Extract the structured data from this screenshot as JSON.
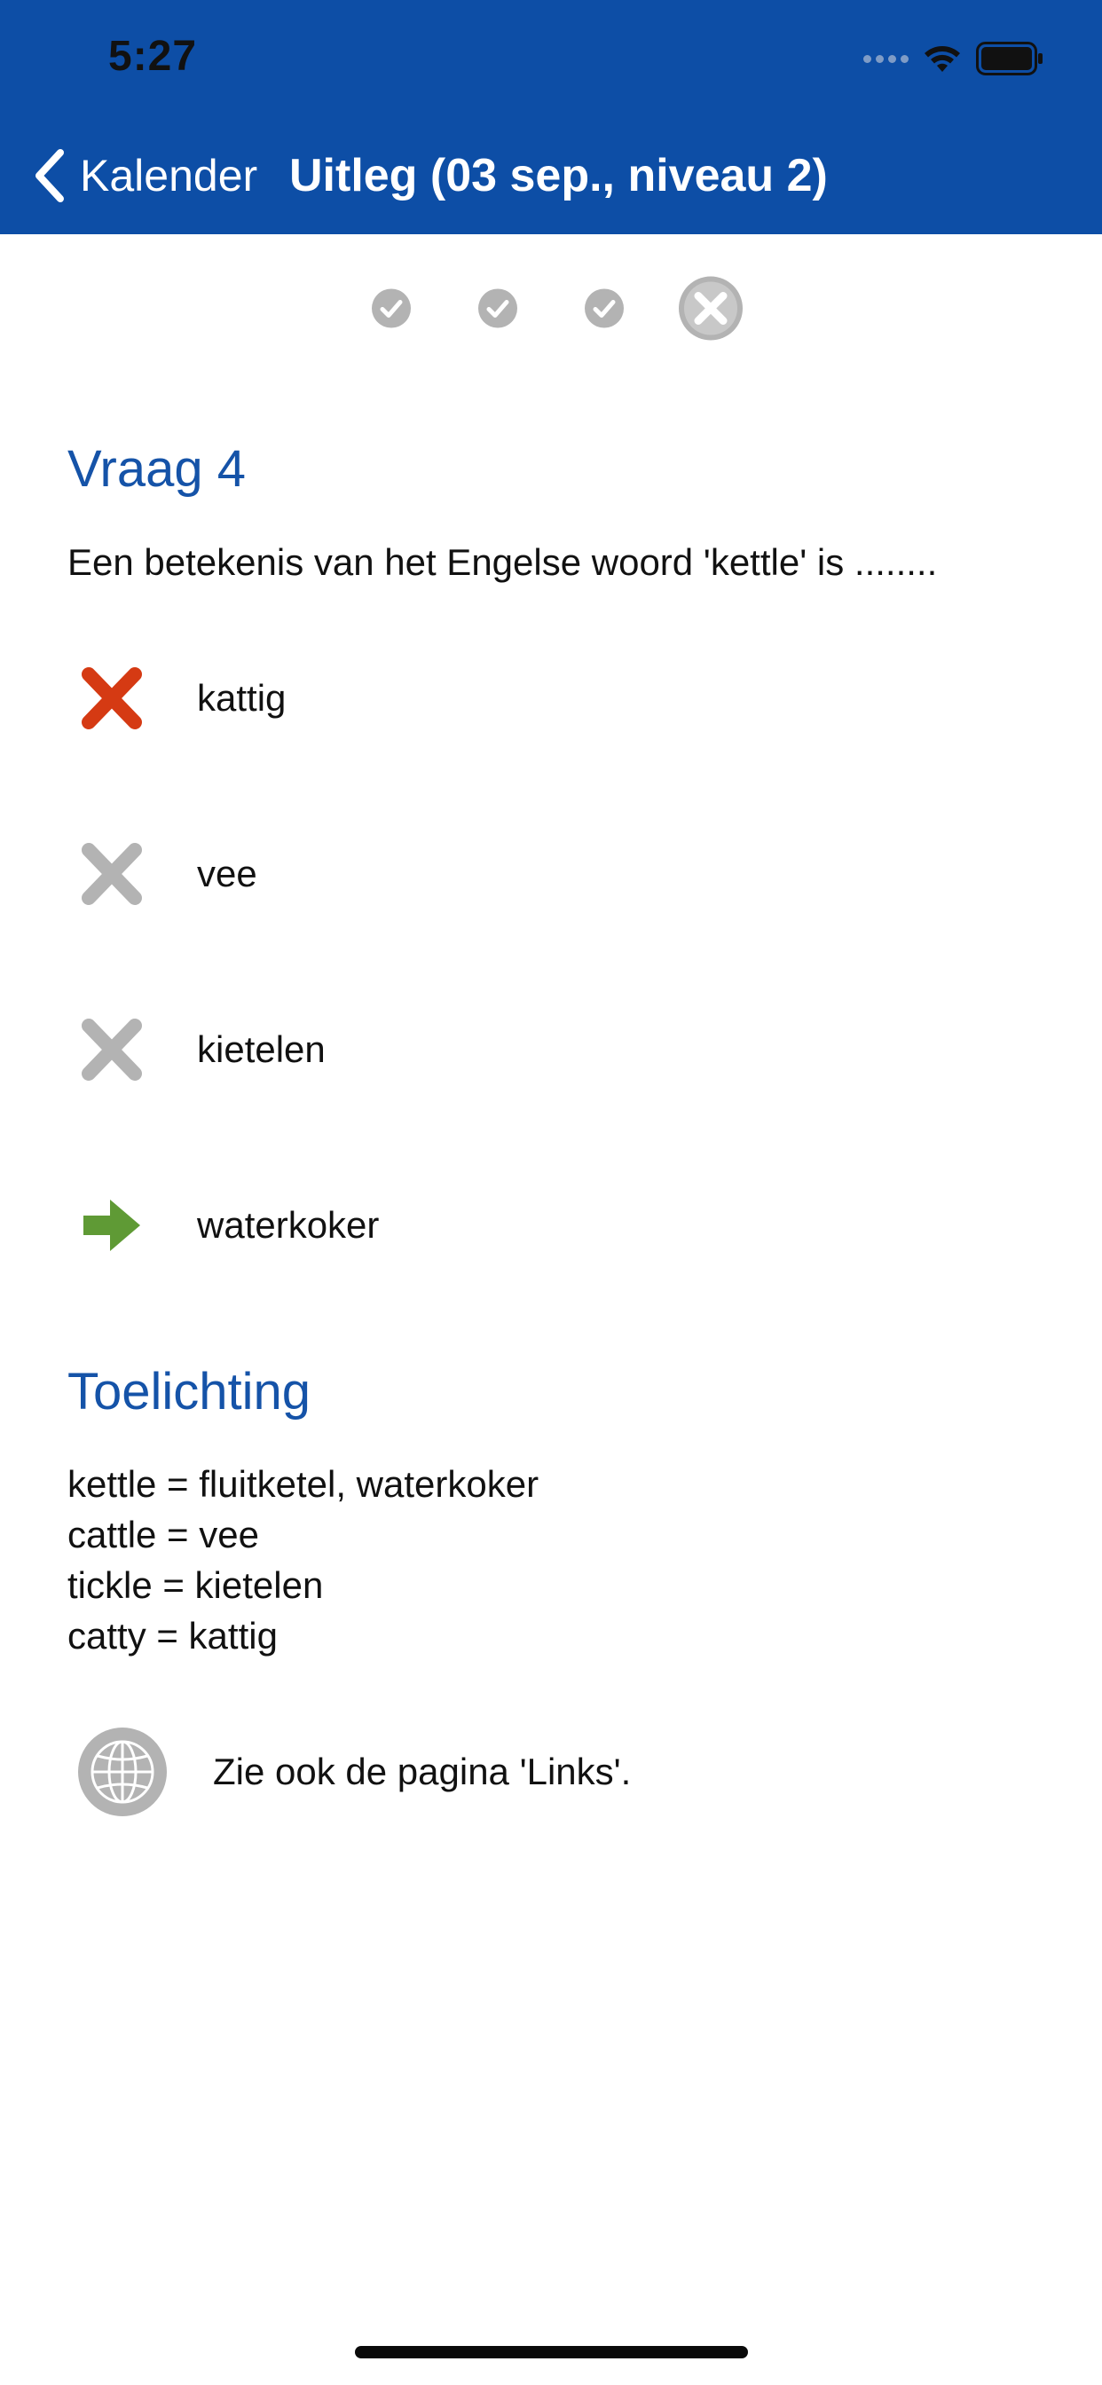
{
  "status_bar": {
    "time": "5:27"
  },
  "nav": {
    "back_label": "Kalender",
    "title": "Uitleg (03 sep., niveau 2)"
  },
  "progress": {
    "steps": [
      "correct",
      "correct",
      "correct",
      "wrong"
    ],
    "current": 4
  },
  "question": {
    "title": "Vraag 4",
    "text": "Een betekenis van het Engelse woord 'kettle' is ........",
    "answers": [
      {
        "label": "kattig",
        "state": "chosen-wrong"
      },
      {
        "label": "vee",
        "state": "wrong"
      },
      {
        "label": "kietelen",
        "state": "wrong"
      },
      {
        "label": "waterkoker",
        "state": "correct"
      }
    ]
  },
  "explanation": {
    "title": "Toelichting",
    "lines": [
      "kettle = fluitketel, waterkoker",
      "cattle = vee",
      "tickle = kietelen",
      "catty = kattig"
    ]
  },
  "links": {
    "label": "Zie ook de pagina 'Links'."
  },
  "colors": {
    "header": "#0d4ea6",
    "heading": "#1553a8",
    "wrong_chosen": "#d53a13",
    "inactive": "#b3b3b3",
    "correct": "#5f9a35"
  }
}
